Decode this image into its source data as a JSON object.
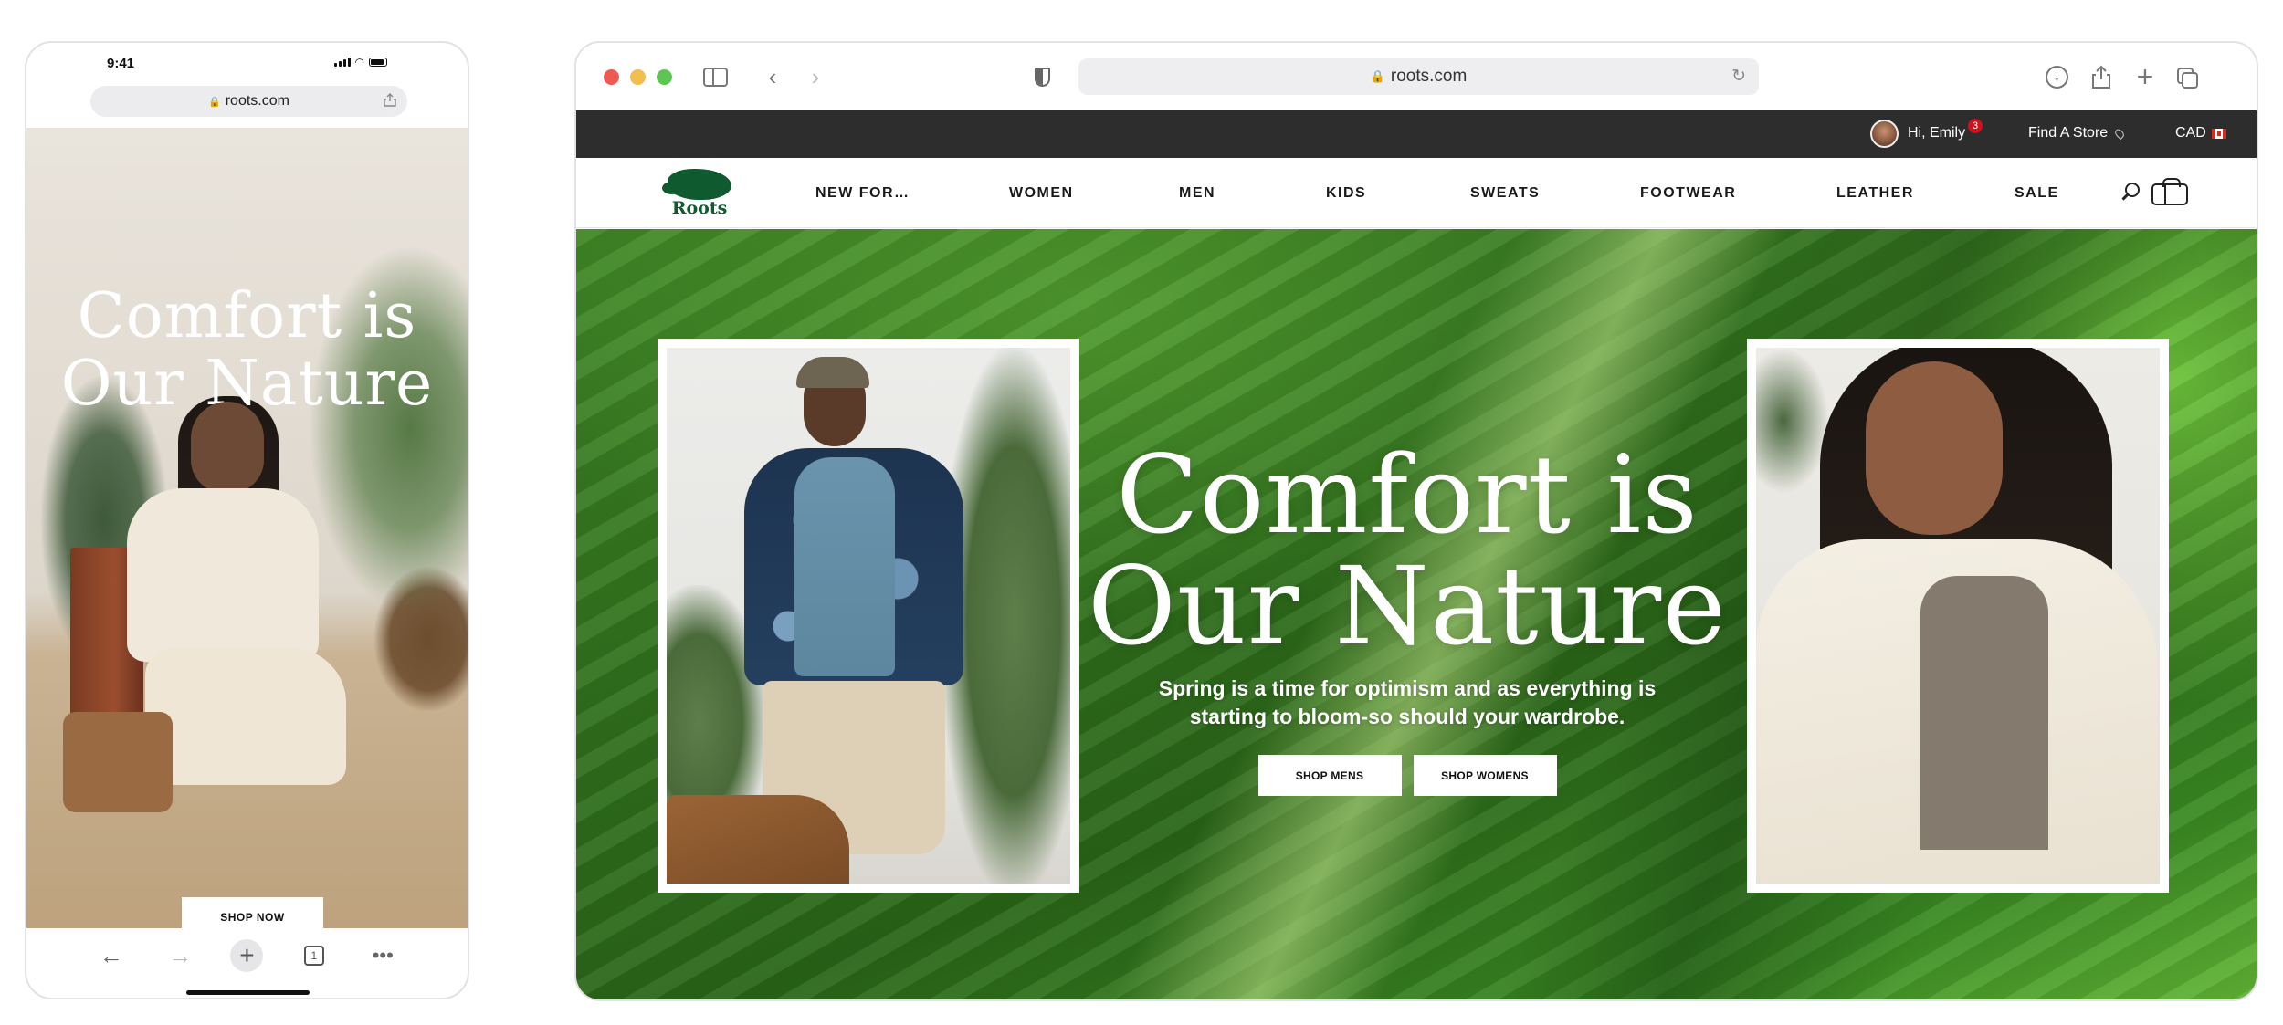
{
  "mobile": {
    "status": {
      "time": "9:41"
    },
    "url": "roots.com",
    "hero": {
      "title_line1": "Comfort is",
      "title_line2": "Our Nature",
      "button": "SHOP NOW"
    },
    "toolbar": {
      "tab_count": "1",
      "back_icon": "arrow-left-icon",
      "forward_icon": "arrow-right-icon",
      "new_tab_icon": "plus-icon",
      "more_icon": "ellipsis-icon"
    }
  },
  "desktop": {
    "address": "roots.com",
    "topbar": {
      "greeting": "Hi, Emily",
      "notifications": "3",
      "store_link": "Find A Store",
      "currency": "CAD"
    },
    "brand": {
      "logo_text": "Roots",
      "color": "#0f5a2e"
    },
    "nav": {
      "items": [
        "NEW FOR…",
        "WOMEN",
        "MEN",
        "KIDS",
        "SWEATS",
        "FOOTWEAR",
        "LEATHER",
        "SALE"
      ]
    },
    "hero": {
      "title_line1": "Comfort is",
      "title_line2": "Our Nature",
      "subtitle": "Spring is a time for optimism and as everything is starting to bloom-so should your wardrobe.",
      "buttons": [
        "SHOP MENS",
        "SHOP WOMENS"
      ]
    }
  },
  "colors": {
    "topbar_bg": "#2d2d2d",
    "hero_green": "#3d8524",
    "badge_red": "#d0121b"
  }
}
